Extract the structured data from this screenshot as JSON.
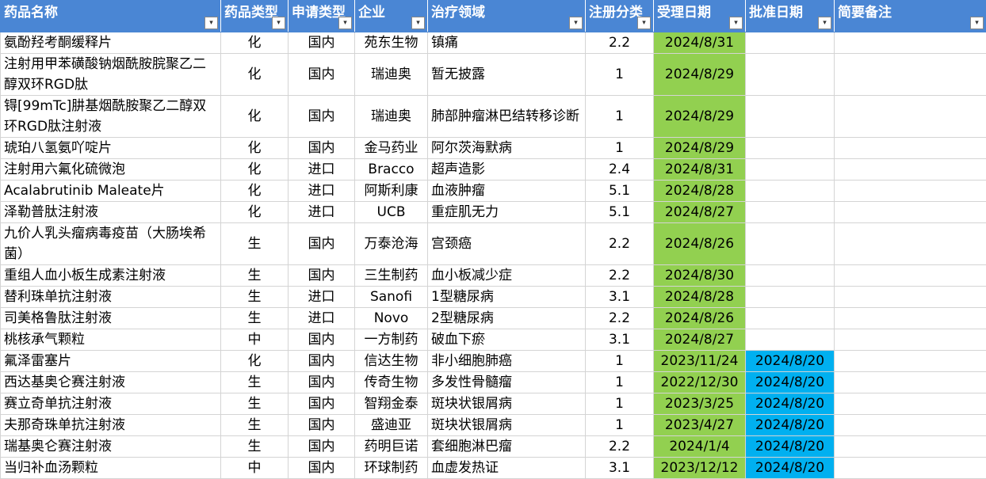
{
  "columns": [
    "药品名称",
    "药品类型",
    "申请类型",
    "企业",
    "治疗领域",
    "注册分类",
    "受理日期",
    "批准日期",
    "简要备注"
  ],
  "filter_icon": "▾",
  "colors": {
    "header_bg": "#4a86d4",
    "accepted_fill": "#92d050",
    "approved_fill": "#00b0f0"
  },
  "rows": [
    {
      "name": "氨酚羟考酮缓释片",
      "type": "化",
      "app": "国内",
      "company": "苑东生物",
      "area": "镇痛",
      "cls": "2.2",
      "accept": "2024/8/31",
      "approve": "",
      "note": ""
    },
    {
      "name": "注射用甲苯磺酸钠烟酰胺脘聚乙二醇双环RGD肽",
      "type": "化",
      "app": "国内",
      "company": "瑞迪奥",
      "area": "暂无披露",
      "cls": "1",
      "accept": "2024/8/29",
      "approve": "",
      "note": ""
    },
    {
      "name": "锝[99mTc]肼基烟酰胺聚乙二醇双环RGD肽注射液",
      "type": "化",
      "app": "国内",
      "company": "瑞迪奥",
      "area": "肺部肿瘤淋巴结转移诊断",
      "cls": "1",
      "accept": "2024/8/29",
      "approve": "",
      "note": ""
    },
    {
      "name": "琥珀八氢氨吖啶片",
      "type": "化",
      "app": "国内",
      "company": "金马药业",
      "area": "阿尔茨海默病",
      "cls": "1",
      "accept": "2024/8/29",
      "approve": "",
      "note": ""
    },
    {
      "name": "注射用六氟化硫微泡",
      "type": "化",
      "app": "进口",
      "company": "Bracco",
      "area": "超声造影",
      "cls": "2.4",
      "accept": "2024/8/31",
      "approve": "",
      "note": ""
    },
    {
      "name": "Acalabrutinib Maleate片",
      "type": "化",
      "app": "进口",
      "company": "阿斯利康",
      "area": "血液肿瘤",
      "cls": "5.1",
      "accept": "2024/8/28",
      "approve": "",
      "note": ""
    },
    {
      "name": "泽勒普肽注射液",
      "type": "化",
      "app": "进口",
      "company": "UCB",
      "area": "重症肌无力",
      "cls": "5.1",
      "accept": "2024/8/27",
      "approve": "",
      "note": ""
    },
    {
      "name": "九价人乳头瘤病毒疫苗（大肠埃希菌）",
      "type": "生",
      "app": "国内",
      "company": "万泰沧海",
      "area": "宫颈癌",
      "cls": "2.2",
      "accept": "2024/8/26",
      "approve": "",
      "note": ""
    },
    {
      "name": "重组人血小板生成素注射液",
      "type": "生",
      "app": "国内",
      "company": "三生制药",
      "area": "血小板减少症",
      "cls": "2.2",
      "accept": "2024/8/30",
      "approve": "",
      "note": ""
    },
    {
      "name": "替利珠单抗注射液",
      "type": "生",
      "app": "进口",
      "company": "Sanofi",
      "area": "1型糖尿病",
      "cls": "3.1",
      "accept": "2024/8/28",
      "approve": "",
      "note": ""
    },
    {
      "name": "司美格鲁肽注射液",
      "type": "生",
      "app": "进口",
      "company": "Novo",
      "area": "2型糖尿病",
      "cls": "2.2",
      "accept": "2024/8/26",
      "approve": "",
      "note": ""
    },
    {
      "name": "桃核承气颗粒",
      "type": "中",
      "app": "国内",
      "company": "一方制药",
      "area": "破血下瘀",
      "cls": "3.1",
      "accept": "2024/8/27",
      "approve": "",
      "note": ""
    },
    {
      "name": "氟泽雷塞片",
      "type": "化",
      "app": "国内",
      "company": "信达生物",
      "area": "非小细胞肺癌",
      "cls": "1",
      "accept": "2023/11/24",
      "approve": "2024/8/20",
      "note": ""
    },
    {
      "name": "西达基奥仑赛注射液",
      "type": "生",
      "app": "国内",
      "company": "传奇生物",
      "area": "多发性骨髓瘤",
      "cls": "1",
      "accept": "2022/12/30",
      "approve": "2024/8/20",
      "note": ""
    },
    {
      "name": "赛立奇单抗注射液",
      "type": "生",
      "app": "国内",
      "company": "智翔金泰",
      "area": "斑块状银屑病",
      "cls": "1",
      "accept": "2023/3/25",
      "approve": "2024/8/20",
      "note": ""
    },
    {
      "name": "夫那奇珠单抗注射液",
      "type": "生",
      "app": "国内",
      "company": "盛迪亚",
      "area": "斑块状银屑病",
      "cls": "1",
      "accept": "2023/4/27",
      "approve": "2024/8/20",
      "note": ""
    },
    {
      "name": "瑞基奥仑赛注射液",
      "type": "生",
      "app": "国内",
      "company": "药明巨诺",
      "area": "套细胞淋巴瘤",
      "cls": "2.2",
      "accept": "2024/1/4",
      "approve": "2024/8/20",
      "note": ""
    },
    {
      "name": "当归补血汤颗粒",
      "type": "中",
      "app": "国内",
      "company": "环球制药",
      "area": "血虚发热证",
      "cls": "3.1",
      "accept": "2023/12/12",
      "approve": "2024/8/20",
      "note": ""
    }
  ]
}
